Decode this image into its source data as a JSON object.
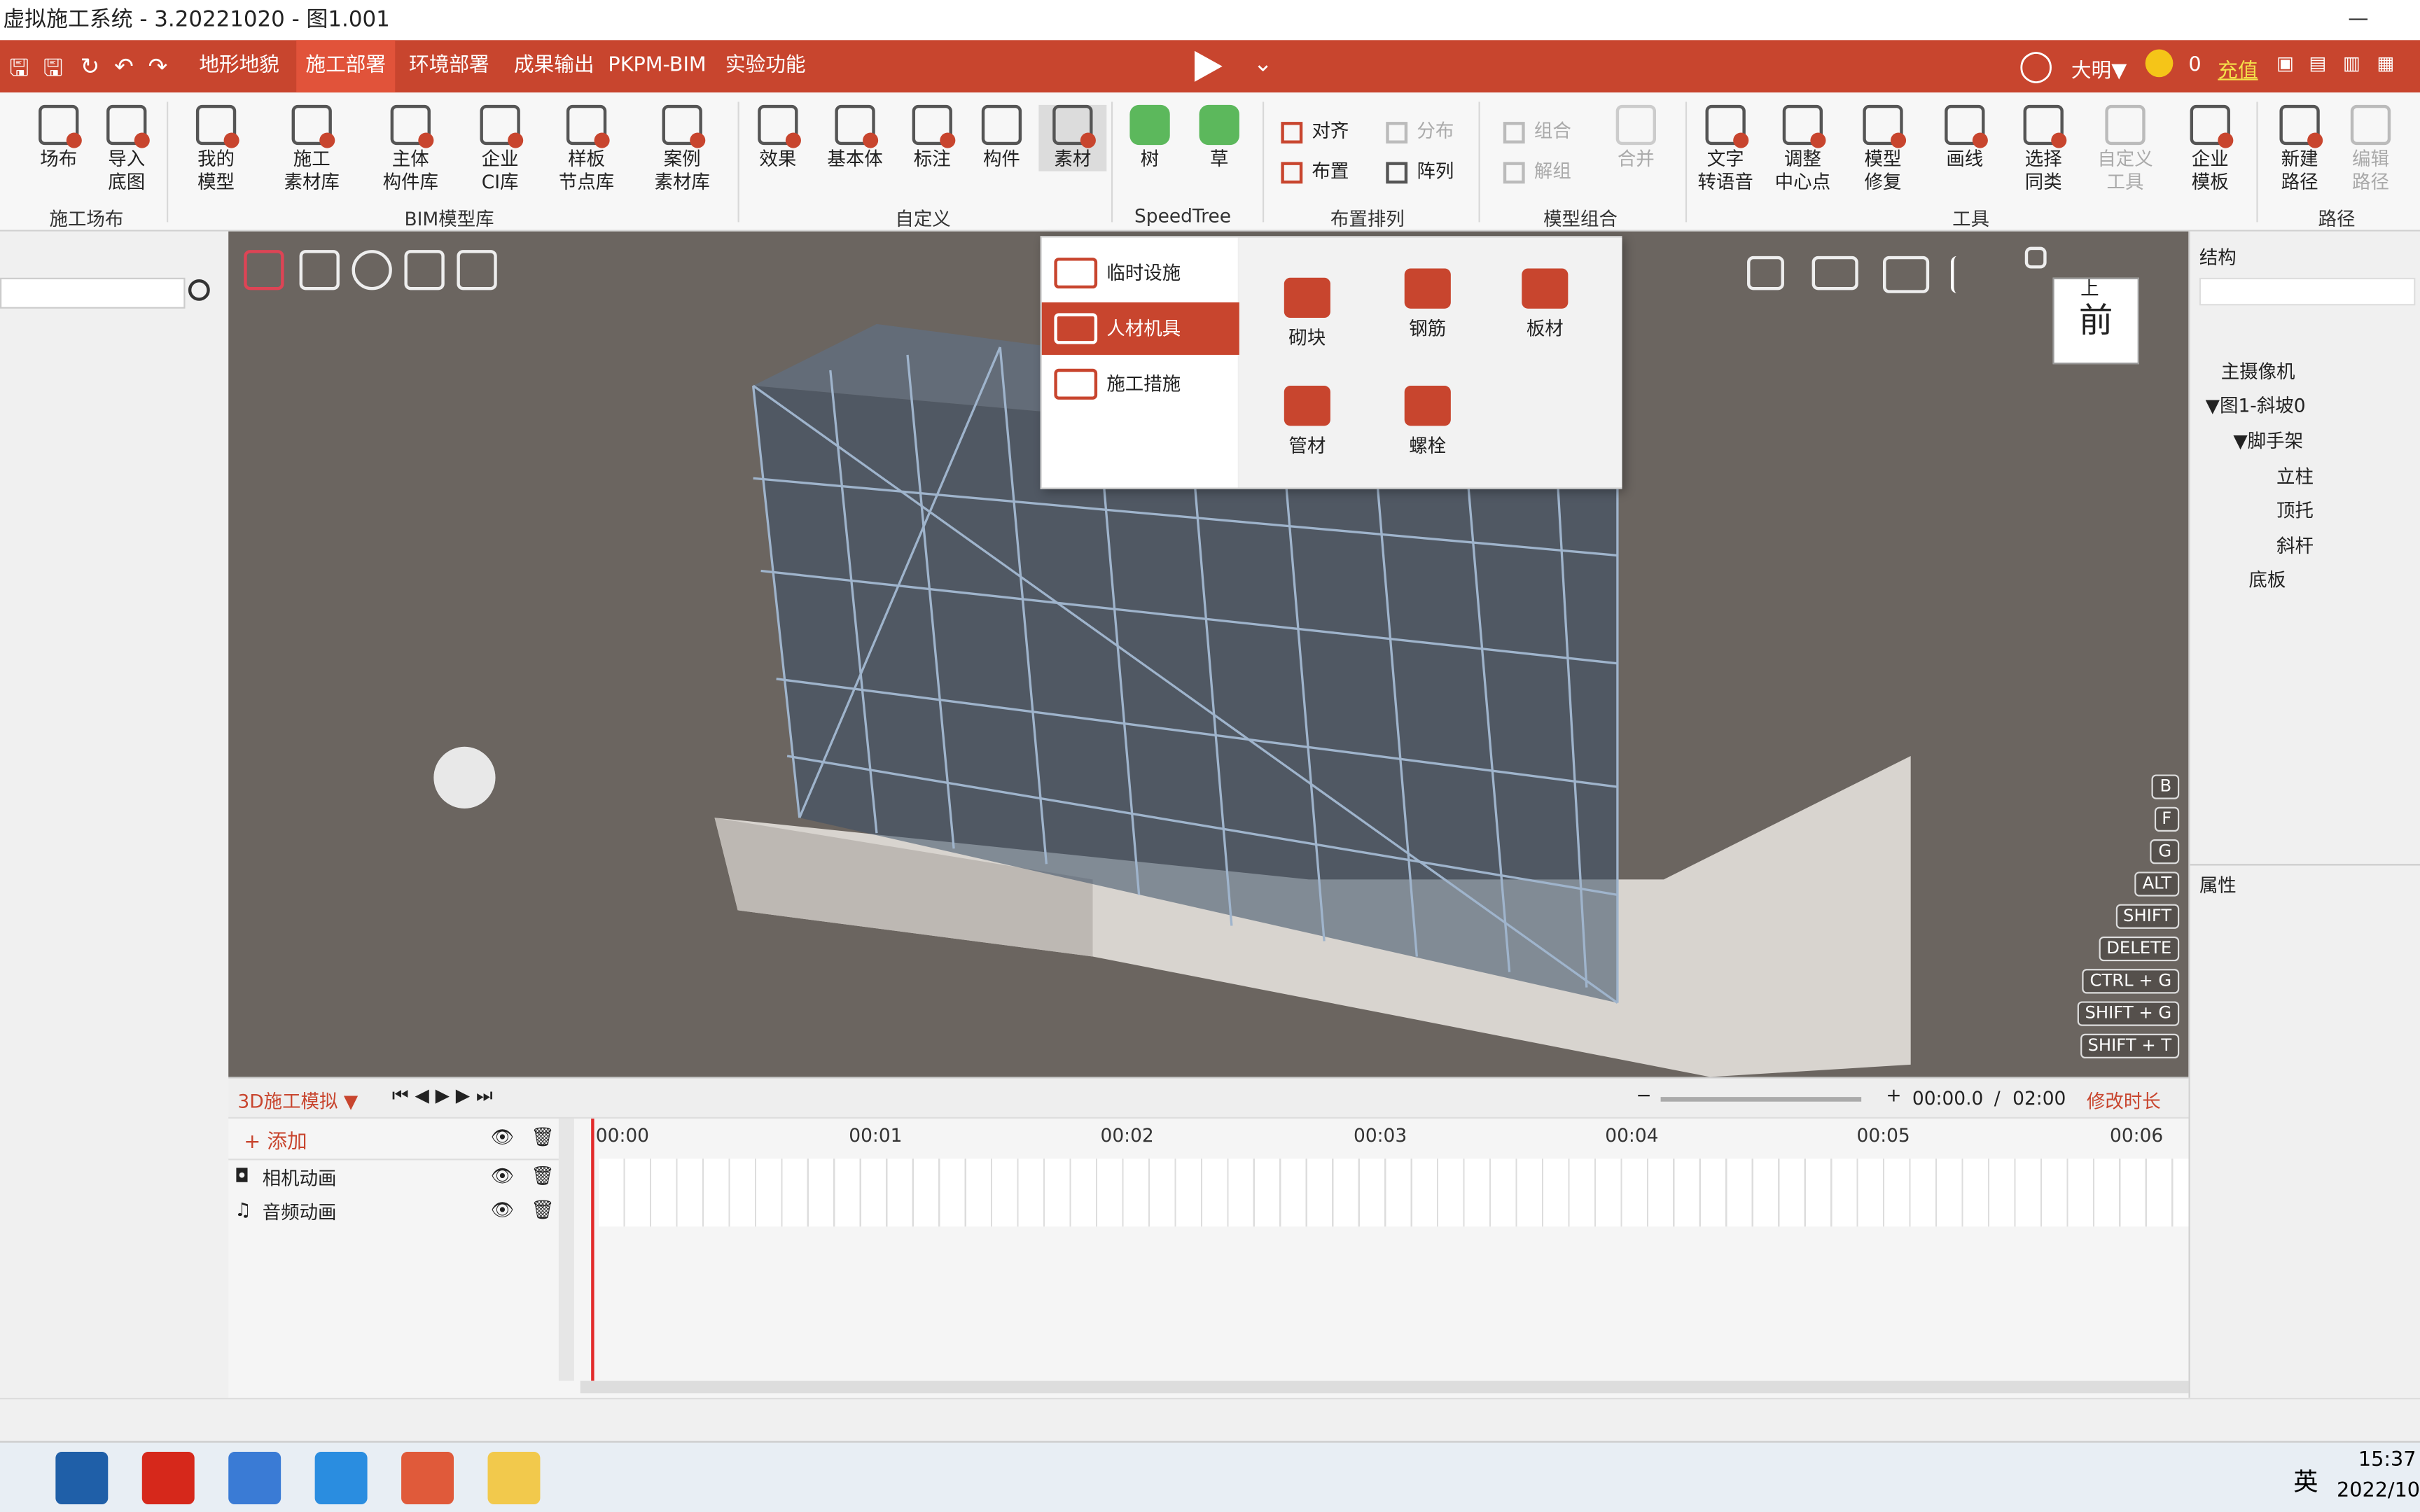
{
  "window": {
    "title": "虚拟施工系统 - 3.20221020 - 图1.001"
  },
  "menu": {
    "tabs": [
      "地形地貌",
      "施工部署",
      "环境部署",
      "成果输出",
      "PKPM-BIM",
      "实验功能"
    ],
    "user": "大明▼",
    "coins": "0",
    "recharge": "充值"
  },
  "ribbon": {
    "site": [
      "场布",
      "导入\n底图"
    ],
    "site_group": "施工场布",
    "bim": [
      "我的\n模型",
      "施工\n素材库",
      "主体\n构件库",
      "企业\nCI库",
      "样板\n节点库",
      "案例\n素材库"
    ],
    "bim_group": "BIM模型库",
    "custom": [
      "效果",
      "基本体",
      "标注",
      "构件",
      "素材"
    ],
    "custom_group": "自定义",
    "speedtree": [
      "树",
      "草"
    ],
    "speedtree_group": "SpeedTree",
    "layout": [
      "对齐",
      "布置",
      "分布",
      "阵列"
    ],
    "layout_group": "布置排列",
    "combine": [
      "组合",
      "解组",
      "合并"
    ],
    "combine_group": "模型组合",
    "tools": [
      "文字\n转语音",
      "调整\n中心点",
      "模型\n修复",
      "画线",
      "选择\n同类",
      "自定义\n工具",
      "企业\n模板"
    ],
    "tools_group": "工具",
    "path": [
      "新建\n路径",
      "编辑\n路径"
    ],
    "path_group": "路径"
  },
  "dropdown": {
    "categories": [
      "临时设施",
      "人材机具",
      "施工措施"
    ],
    "selected": "人材机具",
    "materials": [
      "砌块",
      "钢筋",
      "板材",
      "管材",
      "螺栓"
    ]
  },
  "viewport": {
    "keys": [
      "B",
      "F",
      "G",
      "ALT",
      "SHIFT",
      "DELETE",
      "CTRL + G",
      "SHIFT + G",
      "SHIFT + T"
    ],
    "cube_face": "前",
    "cube_top": "上"
  },
  "rightpanel": {
    "structure_title": "结构",
    "tree": [
      "主摄像机",
      "▼图1-斜坡0",
      "▼脚手架",
      "立柱",
      "顶托",
      "斜杆",
      "底板"
    ],
    "properties_title": "属性"
  },
  "timeline": {
    "mode": "3D施工模拟 ▼",
    "add": "+ 添加",
    "tracks": [
      "相机动画",
      "音频动画"
    ],
    "ticks": [
      "00:00",
      "00:01",
      "00:02",
      "00:03",
      "00:04",
      "00:05",
      "00:06"
    ],
    "current": "00:00.0",
    "separator": "/",
    "total": "02:00",
    "edit_duration": "修改时长"
  },
  "taskbar": {
    "tray_lang": "英",
    "time": "15:37",
    "date": "2022/10"
  },
  "colors": {
    "accent": "#c8452e",
    "viewport": "#6b6560"
  }
}
